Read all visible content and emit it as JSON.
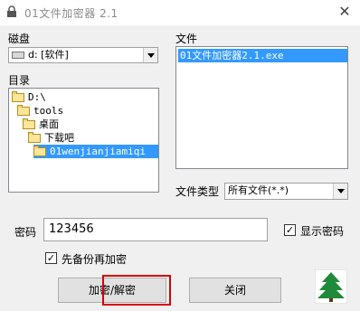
{
  "window": {
    "title": "01文件加密器 2.1",
    "close_glyph": "✕"
  },
  "drive": {
    "label": "磁盘",
    "value": "d: [软件]"
  },
  "directory": {
    "label": "目录",
    "items": [
      "D:\\",
      "tools",
      "桌面",
      "下载吧",
      "01wenjianjiamiqi"
    ],
    "selected_index": 4
  },
  "files": {
    "label": "文件",
    "items": [
      "01文件加密器2.1.exe"
    ],
    "selected_index": 0
  },
  "file_type": {
    "label": "文件类型",
    "value": "所有文件(*.*)"
  },
  "password": {
    "label": "密码",
    "value": "123456",
    "show_label": "显示密码",
    "show_checked": true
  },
  "backup": {
    "label": "先备份再加密",
    "checked": true
  },
  "buttons": {
    "encrypt_decrypt": "加密/解密",
    "close": "关闭"
  },
  "check_glyph": "✓",
  "colors": {
    "selection": "#3399ff",
    "highlight_box": "#d80000",
    "title_text": "#8a8a8a"
  }
}
